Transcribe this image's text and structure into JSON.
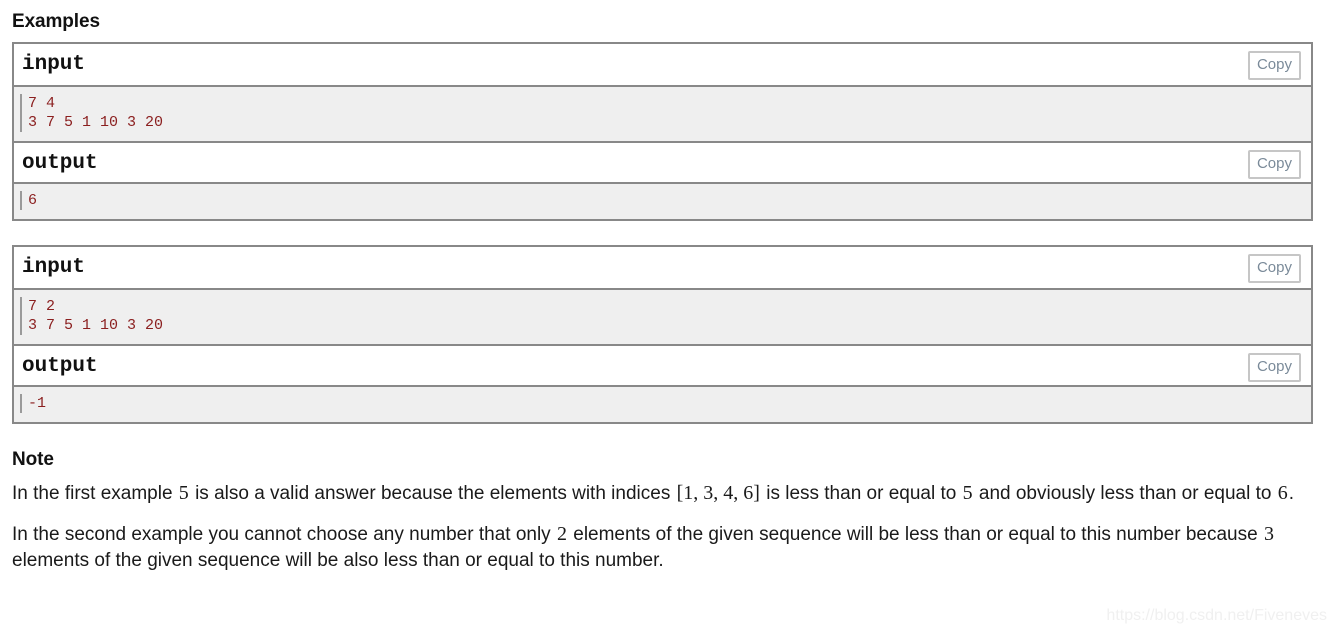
{
  "examples": {
    "heading": "Examples",
    "copy_label": "Copy",
    "blocks": [
      {
        "input_title": "input",
        "input_lines": [
          "7 4",
          "3 7 5 1 10 3 20"
        ],
        "output_title": "output",
        "output_lines": [
          "6"
        ]
      },
      {
        "input_title": "input",
        "input_lines": [
          "7 2",
          "3 7 5 1 10 3 20"
        ],
        "output_title": "output",
        "output_lines": [
          "-1"
        ]
      }
    ]
  },
  "note": {
    "heading": "Note",
    "paragraphs": [
      {
        "parts": [
          {
            "type": "text",
            "value": "In the first example "
          },
          {
            "type": "math",
            "value": "5"
          },
          {
            "type": "text",
            "value": " is also a valid answer because the elements with indices "
          },
          {
            "type": "math",
            "value": "[1, 3, 4, 6]"
          },
          {
            "type": "text",
            "value": " is less than or equal to "
          },
          {
            "type": "math",
            "value": "5"
          },
          {
            "type": "text",
            "value": " and obviously less than or equal to "
          },
          {
            "type": "math",
            "value": "6"
          },
          {
            "type": "text",
            "value": "."
          }
        ]
      },
      {
        "parts": [
          {
            "type": "text",
            "value": "In the second example you cannot choose any number that only "
          },
          {
            "type": "math",
            "value": "2"
          },
          {
            "type": "text",
            "value": " elements of the given sequence will be less than or equal to this number because "
          },
          {
            "type": "math",
            "value": "3"
          },
          {
            "type": "text",
            "value": " elements of the given sequence will be also less than or equal to this number."
          }
        ]
      }
    ]
  },
  "watermark": {
    "text": "https://blog.csdn.net/Fiveneves"
  }
}
